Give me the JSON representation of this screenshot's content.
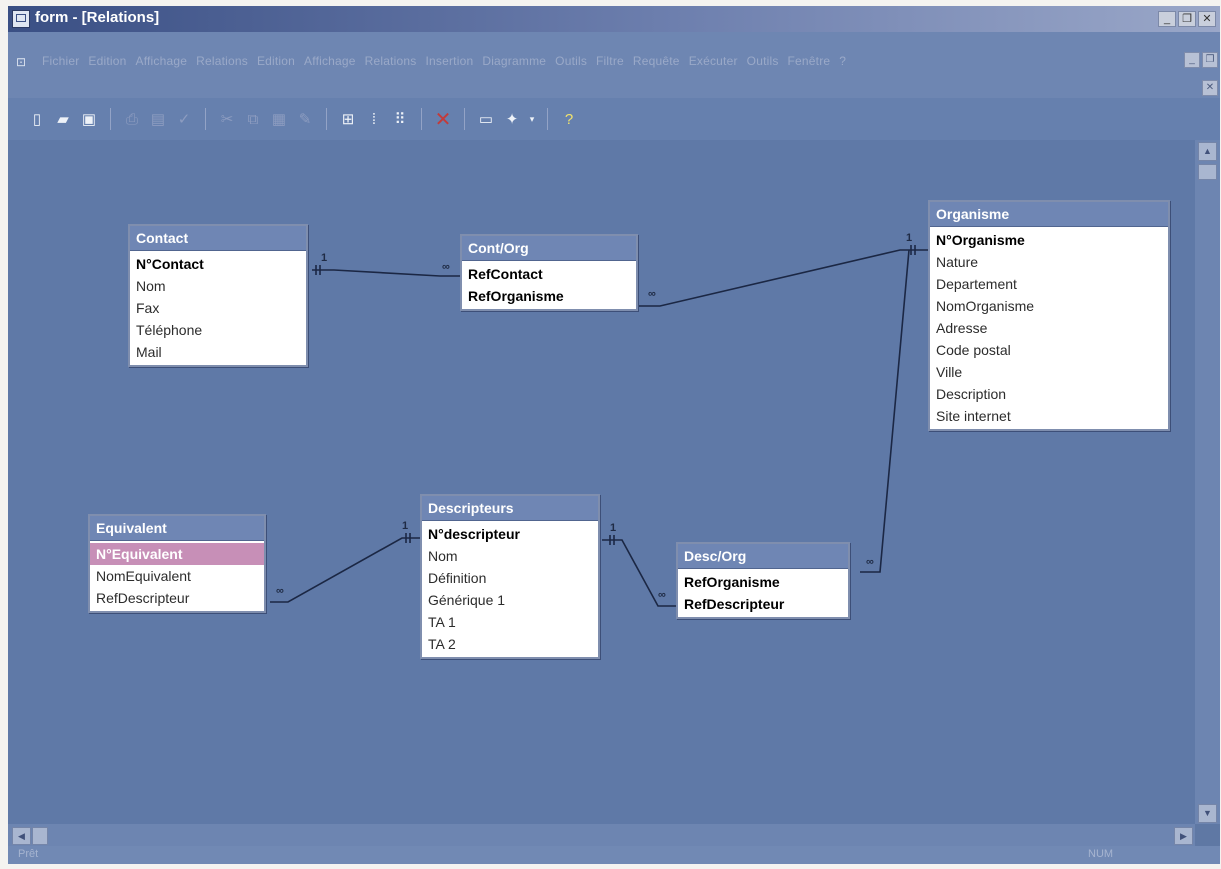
{
  "window": {
    "title": "form - [Relations]"
  },
  "menu": {
    "items": [
      "Fichier",
      "Edition",
      "Affichage",
      "Relations",
      "Edition",
      "Affichage",
      "Relations",
      "Insertion",
      "Diagramme",
      "Outils",
      "Filtre",
      "Requête",
      "Exécuter",
      "Outils",
      "Fenêtre",
      "?"
    ]
  },
  "toolbar": {
    "icons": [
      "new-document",
      "open-folder",
      "save",
      "print",
      "print-preview",
      "spelling",
      "cut",
      "copy",
      "paste",
      "format-painter",
      "add-table",
      "show-direct-relationships",
      "show-all-relationships",
      "delete",
      "properties",
      "new-object",
      "help"
    ]
  },
  "tables": {
    "contact": {
      "title": "Contact",
      "fields": [
        "N°Contact",
        "Nom",
        "Fax",
        "Téléphone",
        "Mail"
      ]
    },
    "contorg": {
      "title": "Cont/Org",
      "fields": [
        "RefContact",
        "RefOrganisme"
      ]
    },
    "organisme": {
      "title": "Organisme",
      "fields": [
        "N°Organisme",
        "Nature",
        "Departement",
        "NomOrganisme",
        "Adresse",
        "Code postal",
        "Ville",
        "Description",
        "Site internet"
      ]
    },
    "equivalent": {
      "title": "Equivalent",
      "fields": [
        "N°Equivalent",
        "NomEquivalent",
        "RefDescripteur"
      ]
    },
    "descripteurs": {
      "title": "Descripteurs",
      "fields": [
        "N°descripteur",
        "Nom",
        "Définition",
        "Générique 1",
        "TA 1",
        "TA 2"
      ]
    },
    "descorg": {
      "title": "Desc/Org",
      "fields": [
        "RefOrganisme",
        "RefDescripteur"
      ]
    }
  },
  "cardinality": {
    "one": "1",
    "many": "∞"
  },
  "status": {
    "left": "Prêt",
    "num": "NUM"
  }
}
